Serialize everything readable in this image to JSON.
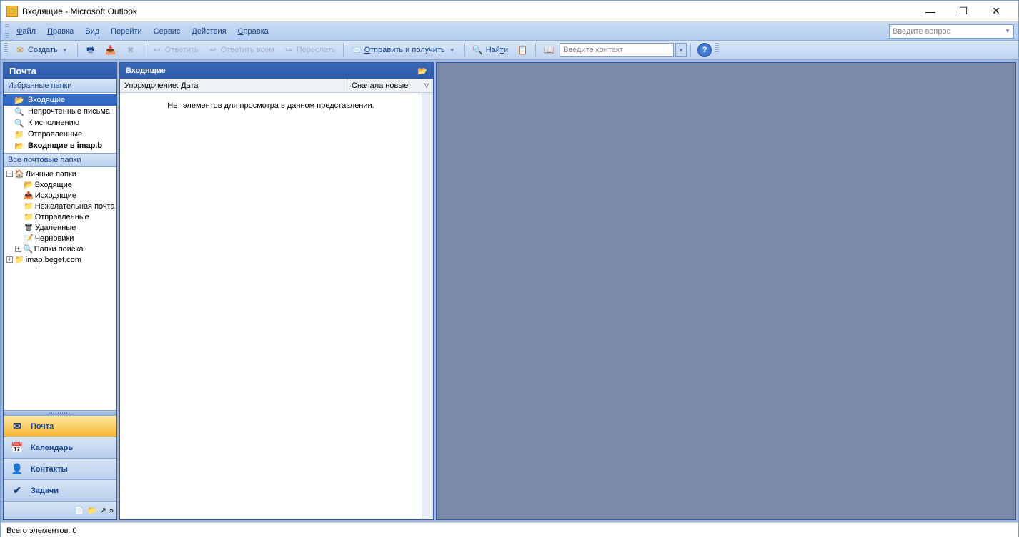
{
  "window": {
    "title": "Входящие - Microsoft Outlook"
  },
  "menu": {
    "file": "Файл",
    "edit": "Правка",
    "view": "Вид",
    "go": "Перейти",
    "tools": "Сервис",
    "actions": "Действия",
    "help": "Справка",
    "question_placeholder": "Введите вопрос"
  },
  "toolbar": {
    "create": "Создать",
    "reply": "Ответить",
    "reply_all": "Ответить всем",
    "forward": "Переслать",
    "send_receive": "Отправить и получить",
    "find": "Найти",
    "contact_placeholder": "Введите контакт"
  },
  "nav": {
    "mail_header": "Почта",
    "favorites_header": "Избранные папки",
    "favorites": {
      "inbox": "Входящие",
      "unread": "Непрочтенные письма",
      "followup": "К исполнению",
      "sent": "Отправленные",
      "imap_inbox": "Входящие в imap.b"
    },
    "all_folders_header": "Все почтовые папки",
    "tree": {
      "personal": "Личные папки",
      "inbox": "Входящие",
      "outbox": "Исходящие",
      "junk": "Нежелательная почта",
      "sent": "Отправленные",
      "deleted": "Удаленные",
      "drafts": "Черновики",
      "search": "Папки поиска",
      "imap": "imap.beget.com"
    },
    "buttons": {
      "mail": "Почта",
      "calendar": "Календарь",
      "contacts": "Контакты",
      "tasks": "Задачи"
    }
  },
  "list": {
    "header": "Входящие",
    "sort_label": "Упорядочение: Дата",
    "sort_order": "Сначала новые",
    "empty_text": "Нет элементов для просмотра в данном представлении."
  },
  "status": {
    "total": "Всего элементов: 0"
  }
}
